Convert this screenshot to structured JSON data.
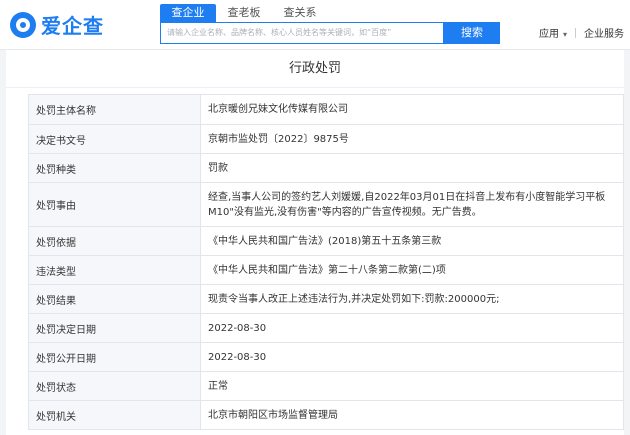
{
  "header": {
    "logo_text": "爱企查",
    "tabs": [
      {
        "label": "查企业",
        "active": true
      },
      {
        "label": "查老板",
        "active": false
      },
      {
        "label": "查关系",
        "active": false
      }
    ],
    "search": {
      "placeholder": "请输入企业名称、品牌名称、核心人员姓名等关键词，如“百度”",
      "button_label": "搜索"
    },
    "nav": {
      "app_label": "应用",
      "caret": "▾",
      "enterprise_service_label": "企业服务"
    }
  },
  "page_title": "行政处罚",
  "rows": [
    {
      "label": "处罚主体名称",
      "value": "北京暖创兄妹文化传媒有限公司"
    },
    {
      "label": "决定书文号",
      "value": "京朝市监处罚〔2022〕9875号"
    },
    {
      "label": "处罚种类",
      "value": "罚款"
    },
    {
      "label": "处罚事由",
      "value": "经查,当事人公司的签约艺人刘媛媛,自2022年03月01日在抖音上发布有小度智能学习平板M10\"没有监光,没有伤害\"等内容的广告宣传视频。无广告费。"
    },
    {
      "label": "处罚依据",
      "value": "《中华人民共和国广告法》(2018)第五十五条第三款"
    },
    {
      "label": "违法类型",
      "value": "《中华人民共和国广告法》第二十八条第二款第(二)项"
    },
    {
      "label": "处罚结果",
      "value": "现责令当事人改正上述违法行为,并决定处罚如下:罚款:200000元;"
    },
    {
      "label": "处罚决定日期",
      "value": "2022-08-30"
    },
    {
      "label": "处罚公开日期",
      "value": "2022-08-30"
    },
    {
      "label": "处罚状态",
      "value": "正常"
    },
    {
      "label": "处罚机关",
      "value": "北京市朝阳区市场监督管理局"
    }
  ]
}
